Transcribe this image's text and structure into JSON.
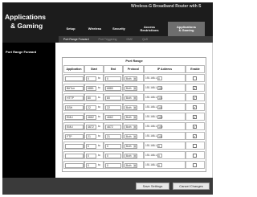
{
  "header": {
    "brand_line1": "Applications",
    "brand_line2": "& Gaming",
    "product": "Wireless-G Broadband Router with S"
  },
  "tabs": [
    {
      "label": "Setup",
      "active": false
    },
    {
      "label": "Wireless",
      "active": false
    },
    {
      "label": "Security",
      "active": false
    },
    {
      "label": "Access\nRestrictions",
      "active": false
    },
    {
      "label": "Applications\n& Gaming",
      "active": true
    }
  ],
  "subtabs": [
    {
      "label": "Port Range Forward",
      "active": true
    },
    {
      "label": "Port Triggering",
      "active": false
    },
    {
      "label": "DMZ",
      "active": false
    },
    {
      "label": "QoS",
      "active": false
    }
  ],
  "sidebar": {
    "label": "Port Range Forward"
  },
  "table": {
    "caption": "Port Range",
    "headers": [
      "Application",
      "Start",
      "End",
      "Protocol",
      "IP Address",
      "Enable"
    ],
    "to_label": "to",
    "ip_prefix": "192.168.1.",
    "rows": [
      {
        "app": "",
        "start": "0",
        "end": "0",
        "protocol": "Both",
        "ip": "0",
        "enabled": false
      },
      {
        "app": "BitTorr",
        "start": "6881",
        "end": "6889",
        "protocol": "Both",
        "ip": "100",
        "enabled": true
      },
      {
        "app": "HTTP",
        "start": "80",
        "end": "80",
        "protocol": "Both",
        "ip": "101",
        "enabled": true
      },
      {
        "app": "SSH",
        "start": "22",
        "end": "22",
        "protocol": "Both",
        "ip": "101",
        "enabled": true
      },
      {
        "app": "EMU",
        "start": "4662",
        "end": "4662",
        "protocol": "Both",
        "ip": "100",
        "enabled": true
      },
      {
        "app": "EMU",
        "start": "4672",
        "end": "4672",
        "protocol": "Both",
        "ip": "100",
        "enabled": true
      },
      {
        "app": "FTP",
        "start": "21",
        "end": "21",
        "protocol": "Both",
        "ip": "101",
        "enabled": true
      },
      {
        "app": "",
        "start": "0",
        "end": "0",
        "protocol": "Both",
        "ip": "0",
        "enabled": false
      },
      {
        "app": "",
        "start": "0",
        "end": "0",
        "protocol": "Both",
        "ip": "0",
        "enabled": false
      },
      {
        "app": "",
        "start": "0",
        "end": "0",
        "protocol": "Both",
        "ip": "0",
        "enabled": false
      }
    ]
  },
  "buttons": {
    "save": "Save Settings",
    "cancel": "Cancel Changes"
  }
}
